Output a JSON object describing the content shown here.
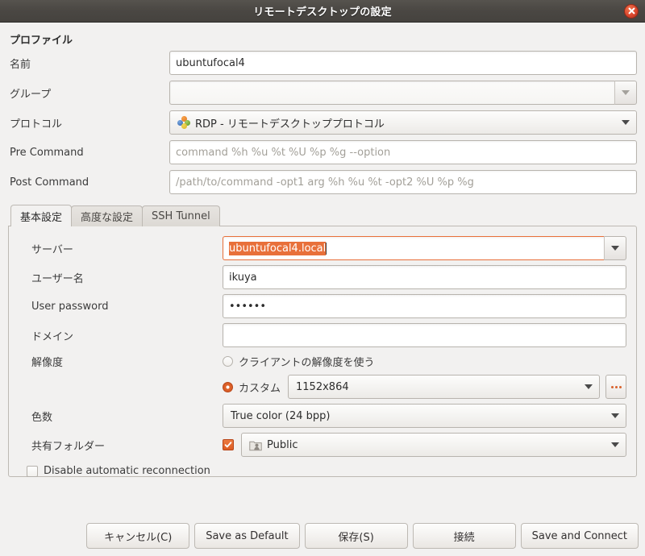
{
  "window": {
    "title": "リモートデスクトップの設定",
    "close_icon": "close-icon"
  },
  "profile": {
    "section_title": "プロファイル",
    "rows": [
      {
        "label": "名前",
        "value": "ubuntufocal4",
        "placeholder": ""
      },
      {
        "label": "グループ",
        "value": "",
        "placeholder": ""
      },
      {
        "label": "プロトコル",
        "value": "RDP - リモートデスクトッププロトコル",
        "icon": "rdp-icon"
      },
      {
        "label": "Pre Command",
        "value": "",
        "placeholder": "command %h %u %t %U %p %g --option"
      },
      {
        "label": "Post Command",
        "value": "",
        "placeholder": "/path/to/command -opt1 arg %h %u %t -opt2 %U %p %g"
      }
    ]
  },
  "tabs": [
    {
      "label": "基本設定",
      "active": true
    },
    {
      "label": "高度な設定",
      "active": false
    },
    {
      "label": "SSH Tunnel",
      "active": false
    }
  ],
  "basic": {
    "server": {
      "label": "サーバー",
      "value": "ubuntufocal4.local",
      "focused": true,
      "selected": true
    },
    "username": {
      "label": "ユーザー名",
      "value": "ikuya"
    },
    "password": {
      "label": "User password",
      "value": "••••••"
    },
    "domain": {
      "label": "ドメイン",
      "value": ""
    },
    "resolution": {
      "label": "解像度",
      "use_client_label": "クライアントの解像度を使う",
      "use_client_selected": false,
      "custom_label": "カスタム",
      "custom_selected": true,
      "custom_value": "1152x864",
      "more_button": "..."
    },
    "color_depth": {
      "label": "色数",
      "value": "True color (24 bpp)"
    },
    "shared_folder": {
      "label": "共有フォルダー",
      "enabled": true,
      "value": "Public",
      "icon": "folder-public-icon"
    },
    "disable_reconnect": {
      "label": "Disable automatic reconnection",
      "checked": false
    }
  },
  "footer": {
    "buttons": [
      {
        "label": "キャンセル(C)"
      },
      {
        "label": "Save as Default"
      },
      {
        "label": "保存(S)"
      },
      {
        "label": "接続"
      },
      {
        "label": "Save and Connect"
      }
    ]
  },
  "colors": {
    "accent": "#dd5c22",
    "titlebar": "#4a4743",
    "window_bg": "#f2f1f0",
    "selection": "#e8703a"
  }
}
